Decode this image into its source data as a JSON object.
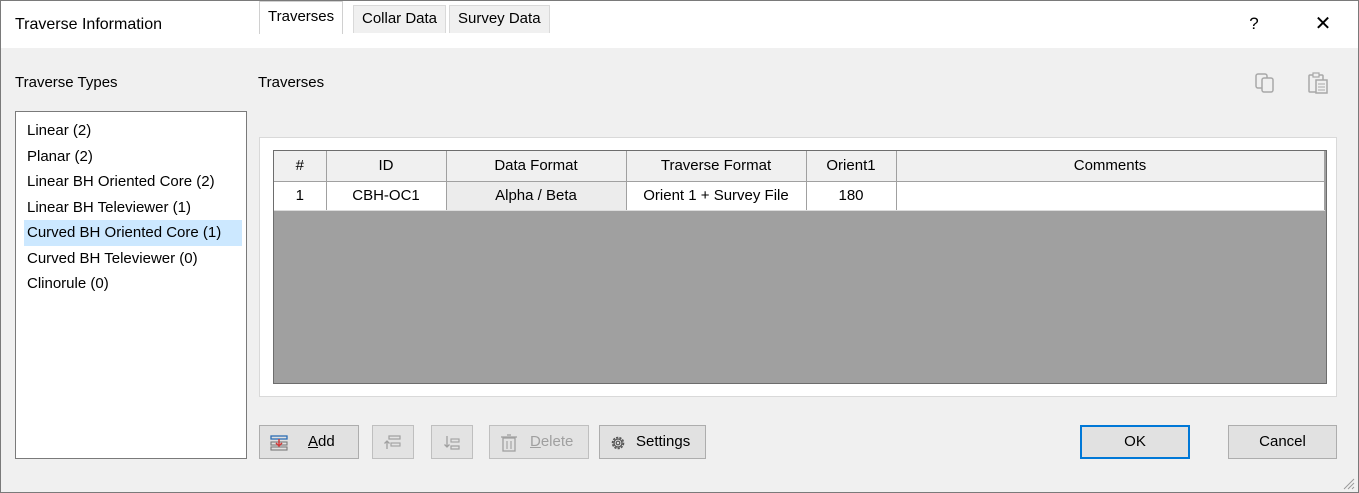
{
  "window": {
    "title": "Traverse Information",
    "help_glyph": "?",
    "close_glyph": "✕"
  },
  "left": {
    "label": "Traverse Types",
    "items": [
      "Linear (2)",
      "Planar (2)",
      "Linear BH Oriented Core (2)",
      "Linear BH Televiewer (1)",
      "Curved BH Oriented Core (1)",
      "Curved BH Televiewer (0)",
      "Clinorule (0)"
    ],
    "selected_index": 4
  },
  "right": {
    "label": "Traverses",
    "toolbar_icons": [
      "copy-icon",
      "paste-icon"
    ],
    "tabs": [
      "Traverses",
      "Collar Data",
      "Survey Data"
    ],
    "active_tab": 0,
    "table": {
      "columns": [
        "#",
        "ID",
        "Data Format",
        "Traverse Format",
        "Orient1",
        "Comments"
      ],
      "rows": [
        [
          "1",
          "CBH-OC1",
          "Alpha / Beta",
          "Orient 1 + Survey File",
          "180",
          ""
        ]
      ]
    }
  },
  "buttons": {
    "add": "Add",
    "move_up_icon": "move-up-icon",
    "move_down_icon": "move-down-icon",
    "delete": "Delete",
    "settings": "Settings",
    "ok": "OK",
    "cancel": "Cancel"
  },
  "colors": {
    "selection": "#cce8ff",
    "grid_background": "#a0a0a0",
    "accent_border": "#0078d7"
  }
}
